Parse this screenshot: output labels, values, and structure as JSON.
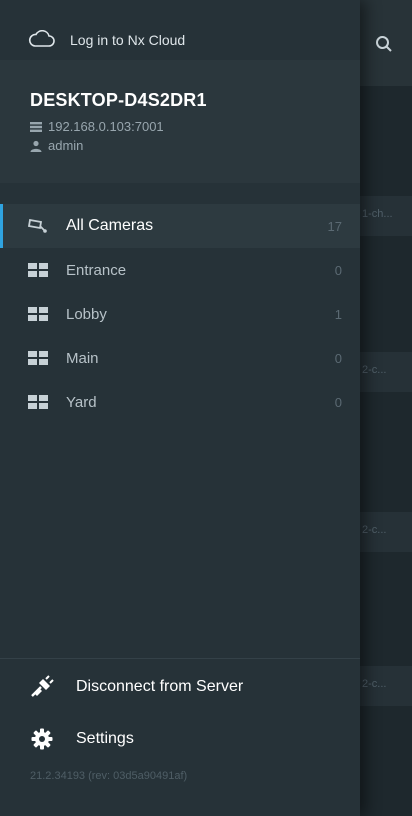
{
  "cloud": {
    "label": "Log in to Nx Cloud"
  },
  "server": {
    "name": "DESKTOP-D4S2DR1",
    "address": "192.168.0.103:7001",
    "user": "admin"
  },
  "groups": [
    {
      "label": "All Cameras",
      "count": "17",
      "icon": "camera-icon"
    },
    {
      "label": "Entrance",
      "count": "0",
      "icon": "layout-icon"
    },
    {
      "label": "Lobby",
      "count": "1",
      "icon": "layout-icon"
    },
    {
      "label": "Main",
      "count": "0",
      "icon": "layout-icon"
    },
    {
      "label": "Yard",
      "count": "0",
      "icon": "layout-icon"
    }
  ],
  "actions": {
    "disconnect_label": "Disconnect from Server",
    "settings_label": "Settings"
  },
  "version": "21.2.34193 (rev: 03d5a90491af)",
  "background": {
    "tiles": [
      "1-ch...",
      "2-c...",
      "2-c...",
      "2-c..."
    ]
  },
  "colors": {
    "accent": "#2fa3e0",
    "drawer_bg": "#263238",
    "server_box_bg": "#2b373d"
  }
}
